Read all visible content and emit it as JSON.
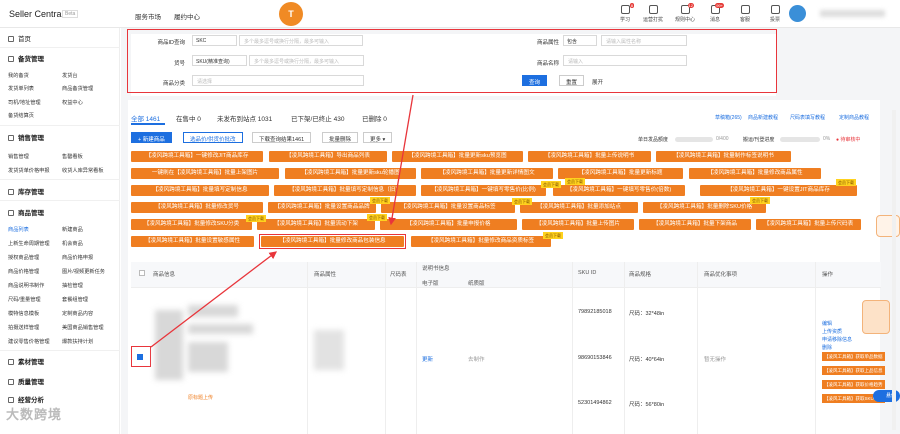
{
  "header": {
    "brand": "Seller Central",
    "beta": "Beta",
    "nav": [
      "服务市场",
      "履约中心"
    ],
    "logo_letter": "T",
    "icons": [
      {
        "label": "学习",
        "badge": "8"
      },
      {
        "label": "运营打扰",
        "badge": ""
      },
      {
        "label": "规则中心",
        "badge": "12"
      },
      {
        "label": "消息",
        "badge": "99+"
      },
      {
        "label": "客服",
        "badge": ""
      },
      {
        "label": "投票",
        "badge": ""
      }
    ]
  },
  "sidebar": {
    "home": "首页",
    "sections": [
      {
        "title": "备货管理",
        "items": [
          [
            "我的备货",
            "发货台"
          ],
          [
            "发货单列表",
            "商品备货管理"
          ],
          [
            "司机/地址管理",
            "权益中心"
          ],
          [
            "备货结算页",
            ""
          ]
        ]
      },
      {
        "title": "销售管理",
        "items": [
          [
            "销售管理",
            "售罄看板"
          ],
          [
            "发货货单价格申报",
            "收货人库异常看板"
          ]
        ]
      },
      {
        "title": "库存管理",
        "items": []
      },
      {
        "title": "商品管理",
        "items": [
          [
            "商品列表",
            "新建商品"
          ],
          [
            "上新生命周期管理",
            "机会商品"
          ],
          [
            "授权商品管理",
            "商品价格申报"
          ],
          [
            "商品价格管理",
            "图片/视频更新任务"
          ],
          [
            "商品说明书制作",
            "抽检管理"
          ],
          [
            "尺码/重量管理",
            "套餐组管理"
          ],
          [
            "模特信息模板",
            "定制商品内容"
          ],
          [
            "拍摄送样管理",
            "美国商品销售管理"
          ],
          [
            "建议零售价格管理",
            "爆款扶持计划"
          ]
        ]
      },
      {
        "title": "素材管理",
        "items": []
      },
      {
        "title": "质量管理",
        "items": []
      },
      {
        "title": "经营分析",
        "items": []
      }
    ]
  },
  "filter": {
    "row1": {
      "label1": "商品ID查询",
      "sel1": "SKC",
      "ph1": "多个最多逗号或换行分隔，最多可输入",
      "label2": "商品属性",
      "sel2": "包含",
      "ph2": "请输入属性名称"
    },
    "row2": {
      "label1": "货号",
      "sel1": "SKU(精准查询)",
      "ph1": "多个最多逗号或换行分隔，最多可输入",
      "label2": "商品名称",
      "ph2": "请输入"
    },
    "row3": {
      "label1": "商品分类",
      "ph1": "请选择",
      "query": "查询",
      "reset": "重置",
      "expand": "展开"
    }
  },
  "tabs": [
    "全部 1461",
    "在售中 0",
    "未发布到站点 1031",
    "已下架/已终止 430",
    "已删除 0"
  ],
  "right_links": [
    "草稿箱(265)",
    "商品新建教程",
    "尺码表填写教程",
    "定制商品教程"
  ],
  "toolbar": {
    "new": "+ 新建商品",
    "batch_price": "选品价/供货价批改",
    "export": "下载查询结果1461",
    "batch_del": "批量删除",
    "more": "更多"
  },
  "progress": {
    "label": "单日发品额度",
    "value": "0/400",
    "label2": "搬运/刊登进度",
    "pct": "0%",
    "status": "待审核中"
  },
  "tool_buttons": [
    [
      "【凌风跨境工具箱】一键修改JIT商品库存",
      "【凌风跨境工具箱】导出商品列表",
      "【凌风跨境工具箱】批量更新sku预览图",
      "【凌风跨境工具箱】批量上传说明书",
      "【凌风跨境工具箱】批量制作标签说明书"
    ],
    [
      "一键刷在【凌风跨境工具箱】批量上架图片",
      "【凌风跨境工具箱】批量更新sku轮播图",
      "【凌风跨境工具箱】批量更新详情图文",
      "【凌风跨境工具箱】批量更新标题",
      "【凌风跨境工具箱】批量修改商品属性"
    ],
    [
      "【凌风跨境工具箱】批量填写定制信息",
      "【凌风跨境工具箱】批量填写定制信息（旧）",
      "【凌风跨境工具箱】一键填写零售价(比例)",
      "【凌风跨境工具箱】一键填写零售价(倍数)",
      "【凌风跨境工具箱】一键设置JIT商品库存"
    ],
    [
      "【凌风跨境工具箱】批量修改货号",
      "【凌风跨境工具箱】批量设置商品品牌",
      "【凌风跨境工具箱】批量设置商品标签",
      "【凌风跨境工具箱】批量添加站点",
      "【凌风跨境工具箱】批量删除SKU价格"
    ],
    [
      "【凌风跨境工具箱】批量修改SKU分类",
      "【凌风跨境工具箱】批量流动下架",
      "【凌风跨境工具箱】批量申报价格",
      "【凌风跨境工具箱】批量上传图片",
      "【凌风跨境工具箱】批量下架商品",
      "【凌风跨境工具箱】批量上传尺码表"
    ],
    [
      "【凌风跨境工具箱】批量设置敏感属性",
      "【凌风跨境工具箱】批量修改商品包装信息",
      "【凌风跨境工具箱】批量修改商品资质标签"
    ]
  ],
  "badges": [
    "会员下载",
    "会员下载",
    "会员下载",
    "会员下载",
    "会员下载",
    "会员下载",
    "会员下载",
    "会员下载",
    "会员下载"
  ],
  "table": {
    "headers": [
      "商品信息",
      "商品属性",
      "尺码表",
      "说明书信息",
      "SKU ID",
      "商品规格",
      "商品优化事项",
      "操作"
    ],
    "sub_headers": [
      "电子版",
      "纸质版"
    ],
    "status": "更新",
    "sub_text": "去制作",
    "opt": "暂无操作",
    "skus": [
      {
        "id": "79892185018",
        "spec": "尺码：32*48in"
      },
      {
        "id": "98690153846",
        "spec": "尺码：40*64in"
      },
      {
        "id": "52301494862",
        "spec": "尺码：56*80in"
      }
    ],
    "op_links": [
      "编辑",
      "上传资质",
      "申请移除信息",
      "删除"
    ],
    "op_tools": [
      "【凌风工具箱】获取单品数据",
      "【凌风工具箱】获取上品信息",
      "【凌风工具箱】获取价格趋势",
      "【凌风工具箱】获取SKU信息"
    ],
    "left_link": "原标题上传"
  },
  "misc": {
    "toggle": "悬停",
    "watermark": "大数跨境"
  }
}
